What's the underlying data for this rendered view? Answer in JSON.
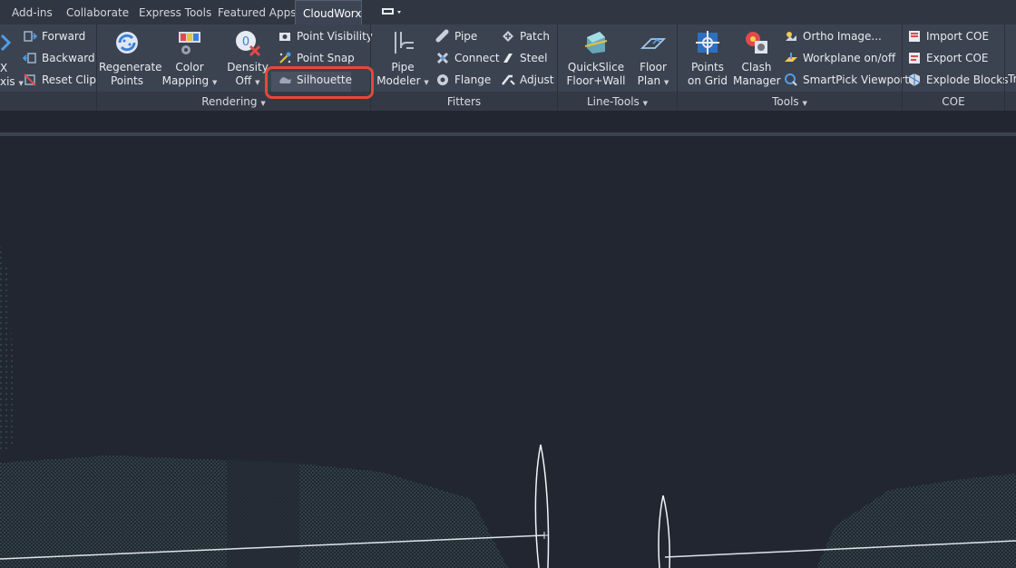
{
  "tabs": [
    {
      "label": "Add-ins",
      "active": false
    },
    {
      "label": "Collaborate",
      "active": false
    },
    {
      "label": "Express Tools",
      "active": false
    },
    {
      "label": "Featured Apps",
      "active": false
    },
    {
      "label": "CloudWorx",
      "active": true
    }
  ],
  "clip": {
    "partial_label_top": "X",
    "partial_label_bottom": "xis",
    "forward": "Forward",
    "backward": "Backward",
    "reset_clip": "Reset Clip"
  },
  "rendering": {
    "title": "Rendering",
    "regenerate_1": "Regenerate",
    "regenerate_2": "Points",
    "color_1": "Color",
    "color_2": "Mapping",
    "density_1": "Density",
    "density_2": "Off",
    "density_badge": "0",
    "point_visibility": "Point Visibility",
    "point_snap": "Point Snap",
    "silhouette": "Silhouette"
  },
  "fitters": {
    "title": "Fitters",
    "pipe_modeler_1": "Pipe",
    "pipe_modeler_2": "Modeler",
    "pipe": "Pipe",
    "connect": "Connect",
    "flange": "Flange",
    "patch": "Patch",
    "steel": "Steel",
    "adjust": "Adjust"
  },
  "line_tools": {
    "title": "Line-Tools",
    "quickslice_1": "QuickSlice",
    "quickslice_2": "Floor+Wall",
    "floor_1": "Floor",
    "floor_2": "Plan"
  },
  "tools": {
    "title": "Tools",
    "points_grid_1": "Points",
    "points_grid_2": "on Grid",
    "clash_1": "Clash",
    "clash_2": "Manager",
    "ortho": "Ortho Image...",
    "workplane": "Workplane on/off",
    "smartpick": "SmartPick Viewport"
  },
  "coe": {
    "title": "COE",
    "import": "Import COE",
    "export": "Export COE",
    "explode": "Explode Blocks"
  },
  "partial_right": "Tr",
  "colors": {
    "ribbon_bg": "#3b4350",
    "tabbar_bg": "#303742",
    "viewport_bg": "#212631",
    "highlight": "#e8473a",
    "pointcloud": "#5fae9a"
  }
}
